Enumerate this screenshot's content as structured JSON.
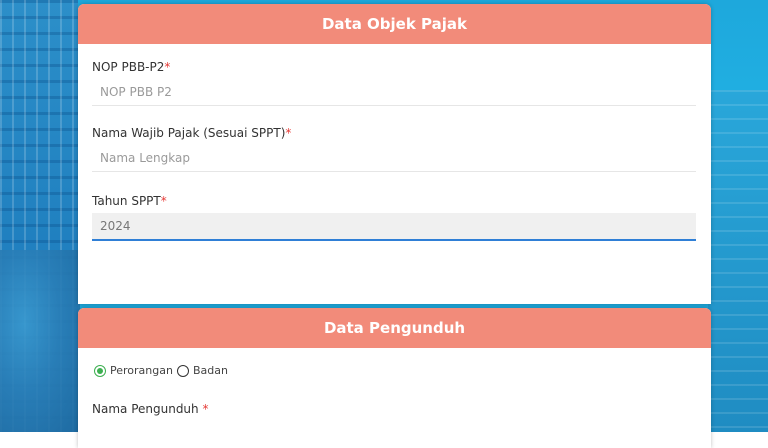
{
  "section_objek": {
    "title": "Data Objek Pajak",
    "nop": {
      "label": "NOP PBB-P2",
      "required_mark": "*",
      "placeholder": "NOP PBB P2"
    },
    "nama_wp": {
      "label": "Nama Wajib Pajak (Sesuai SPPT)",
      "required_mark": "*",
      "placeholder": "Nama Lengkap"
    },
    "tahun": {
      "label": "Tahun SPPT",
      "required_mark": "*",
      "value": "2024"
    }
  },
  "section_pengunduh": {
    "title": "Data Pengunduh",
    "type_options": [
      "Perorangan",
      "Badan"
    ],
    "type_selected": "Perorangan",
    "nama": {
      "label": "Nama Pengunduh ",
      "required_mark": "*"
    }
  },
  "colors": {
    "header": "#f28b7a",
    "required": "#e53935",
    "focus": "#2f7fd6",
    "radio_checked": "#3caf50"
  }
}
